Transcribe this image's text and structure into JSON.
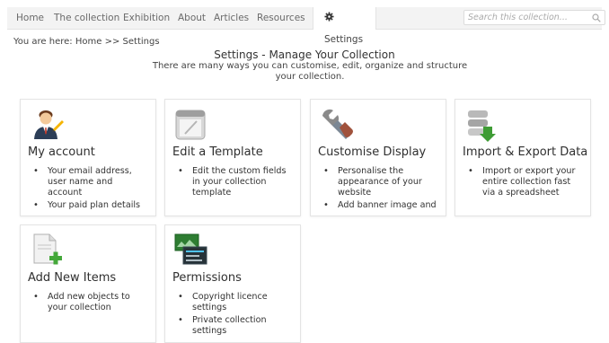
{
  "nav": {
    "items": [
      "Home",
      "The collection",
      "Exhibition",
      "About",
      "Articles",
      "Resources"
    ],
    "active": "Settings",
    "search_placeholder": "Search this collection..."
  },
  "breadcrumb": {
    "prefix": "You are here:",
    "home": "Home",
    "separator": ">>",
    "current": "Settings"
  },
  "header": {
    "title": "Settings - Manage Your Collection",
    "subtitle": "There are many ways you can customise, edit, organize and structure your collection."
  },
  "cards": [
    {
      "title": "My account",
      "icon": "user-icon",
      "bullets": [
        "Your email address, user name and account",
        "Your paid plan details"
      ]
    },
    {
      "title": "Edit a Template",
      "icon": "template-icon",
      "bullets": [
        "Edit the custom fields in your collection template"
      ]
    },
    {
      "title": "Customise Display",
      "icon": "wrench-icon",
      "bullets": [
        "Personalise the appearance of your website",
        "Add banner image and"
      ]
    },
    {
      "title": "Import & Export Data",
      "icon": "database-icon",
      "bullets": [
        "Import or export your entire collection fast via a spreadsheet"
      ]
    },
    {
      "title": "Add New Items",
      "icon": "add-document-icon",
      "bullets": [
        "Add new objects to your collection"
      ]
    },
    {
      "title": "Permissions",
      "icon": "permissions-icon",
      "bullets": [
        "Copyright licence settings",
        "Private collection settings"
      ]
    }
  ]
}
